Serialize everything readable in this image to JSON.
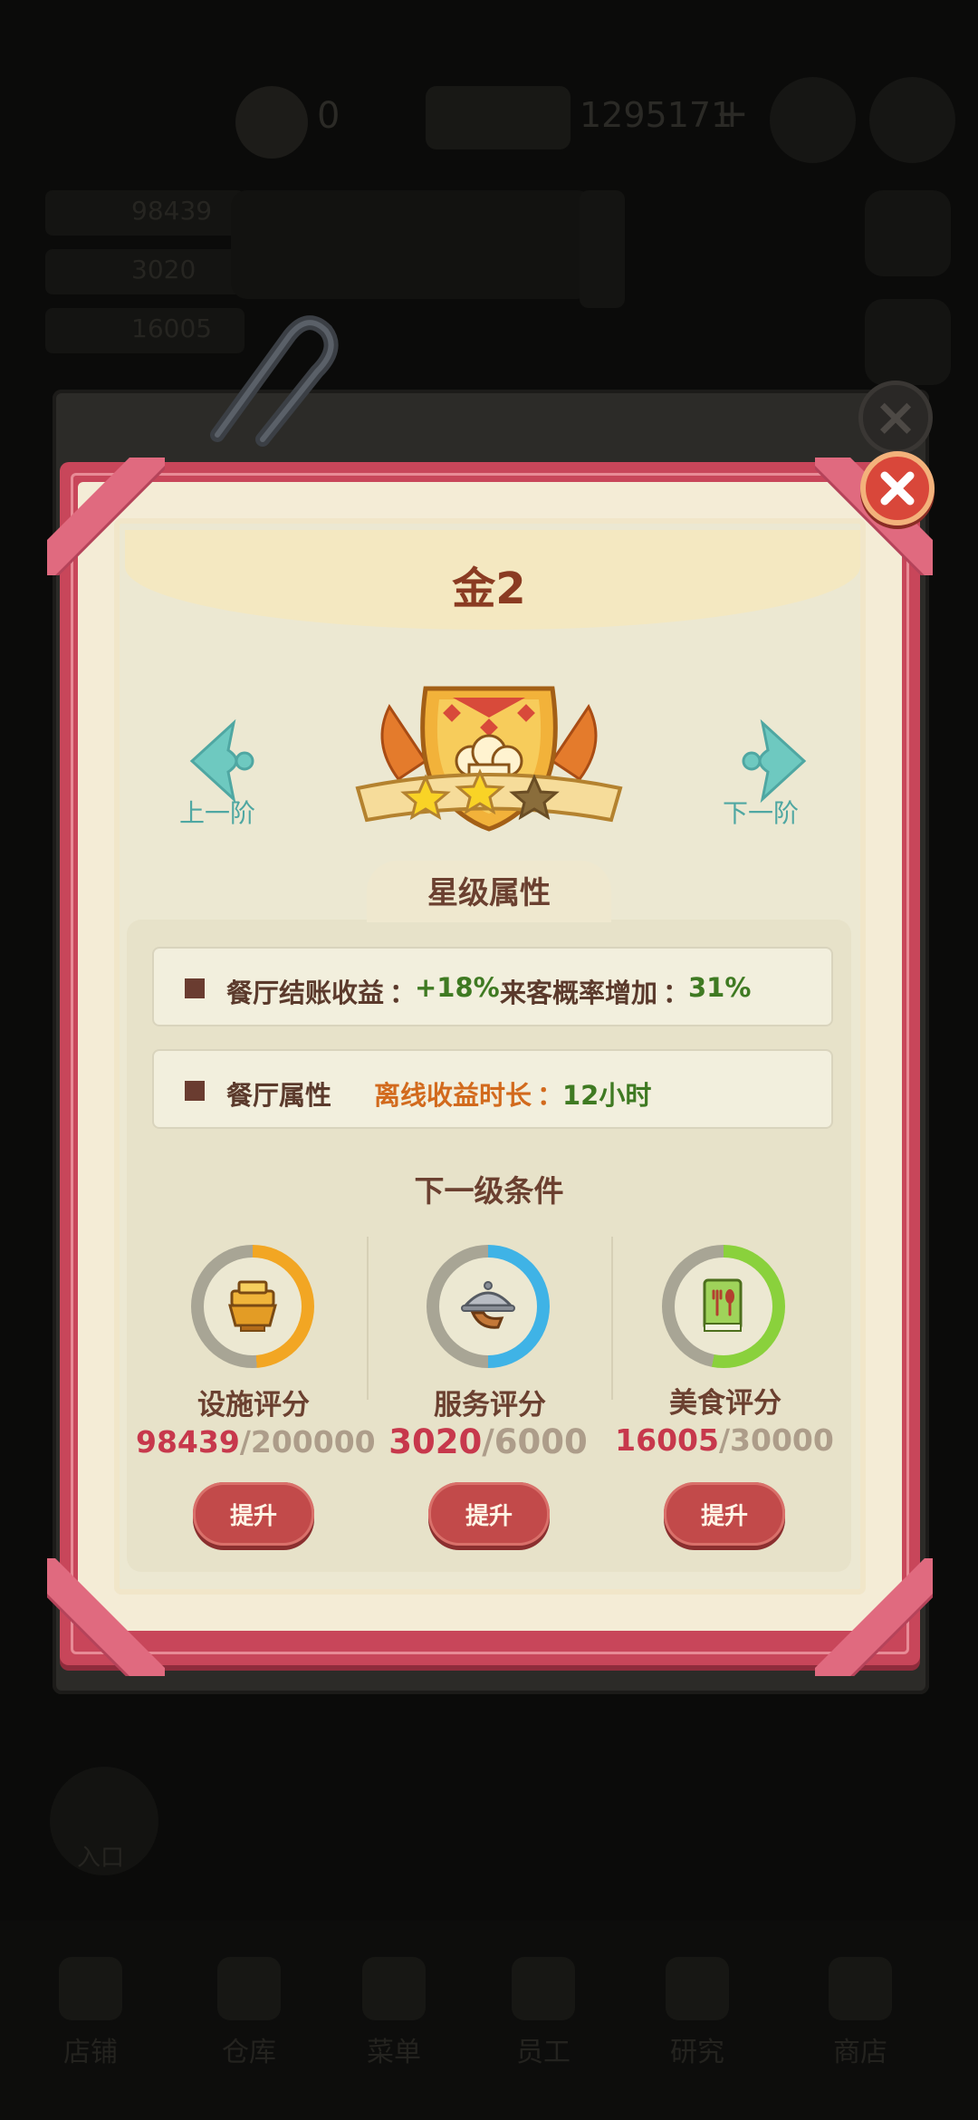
{
  "background": {
    "coins": "0",
    "money": "1295171",
    "plus": "+",
    "stats": [
      "98439",
      "3020",
      "16005"
    ],
    "left_button_label": "入口",
    "tabs": [
      "店铺",
      "仓库",
      "菜单",
      "员工",
      "研究",
      "商店"
    ]
  },
  "popup": {
    "title": "金2",
    "prev_label": "上一阶",
    "next_label": "下一阶",
    "stars_filled": 2,
    "stars_total": 3,
    "star_section_title": "星级属性",
    "rows": [
      {
        "name": "餐厅结账收益",
        "sep": "：",
        "value": "+18%",
        "name2": "来客概率增加",
        "sep2": "：",
        "value2": "31%"
      },
      {
        "name": "餐厅属性",
        "label": "离线收益时长",
        "sep": "：",
        "value": "12小时"
      }
    ],
    "next_section_title": "下一级条件",
    "categories": [
      {
        "label": "设施评分",
        "current": "98439",
        "max": "/200000",
        "progress": 0.49,
        "ring_color": "#f2a623",
        "icon": "hotpot-icon",
        "button": "提升"
      },
      {
        "label": "服务评分",
        "current": "3020",
        "max": "/6000",
        "progress": 0.5,
        "ring_color": "#3fb3e6",
        "icon": "serving-tray-icon",
        "button": "提升"
      },
      {
        "label": "美食评分",
        "current": "16005",
        "max": "/30000",
        "progress": 0.53,
        "ring_color": "#8ad13c",
        "icon": "recipe-book-icon",
        "button": "提升"
      }
    ]
  },
  "colors": {
    "frame": "#c8465a",
    "paper": "#f4ecd6",
    "accent_teal": "#4fa7a2",
    "value_red": "#c7384c",
    "button": "#c24a4a"
  }
}
